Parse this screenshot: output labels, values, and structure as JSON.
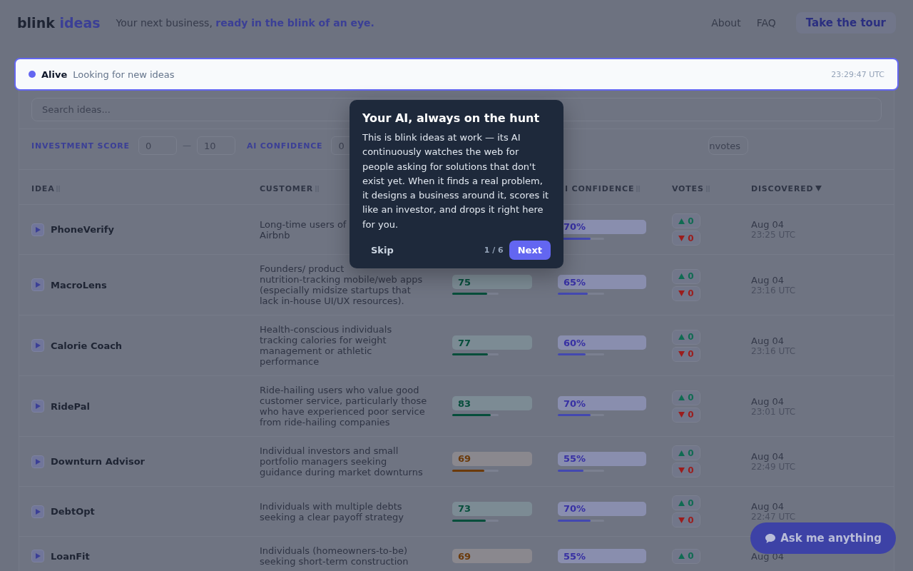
{
  "header": {
    "logo": {
      "first": "blink",
      "second": "ideas"
    },
    "tagline": "Your next business, **ready in the blink of an eye.**",
    "nav": [
      "About",
      "FAQ"
    ],
    "tour_button": "Take the tour"
  },
  "status": {
    "state": "Alive",
    "color": "#6366f1",
    "message": "Looking for new ideas",
    "time": "23:29:47 UTC"
  },
  "search": {
    "placeholder": "Search ideas..."
  },
  "filters": {
    "investment_label": "INVESTMENT SCORE",
    "investment_min": "0",
    "separator": "—",
    "investment_max": "10",
    "confidence_label": "AI CONFIDENCE",
    "confidence_min": "0",
    "downvotes_button": "nvotes"
  },
  "columns": [
    {
      "kind": "idea",
      "label": "IDEA",
      "sorted": false
    },
    {
      "kind": "customer",
      "label": "CUSTOMER",
      "sorted": false
    },
    {
      "kind": "confidence",
      "label": "I CONFIDENCE",
      "sorted": false
    },
    {
      "kind": "votes",
      "label": "VOTES",
      "sorted": false
    },
    {
      "kind": "discovered",
      "label": "DISCOVERED",
      "sorted": true
    }
  ],
  "rows": [
    {
      "name": "PhoneVerify",
      "customer": [
        "Long-time users of",
        "Airbnb"
      ],
      "confidence": {
        "value": "70%",
        "level": 0.7
      },
      "up": "0",
      "down": "0",
      "date": "Aug 04",
      "time": "23:25 UTC"
    },
    {
      "name": "MacroLens",
      "customer": [
        "Founders/ product",
        "nutrition-tracking mobile/web apps",
        "(especially midsize startups that",
        "lack in-house UI/UX resources)."
      ],
      "score": {
        "value": "75",
        "level": 0.75,
        "color": "#064e3b"
      },
      "confidence": {
        "value": "65%",
        "level": 0.65
      },
      "up": "0",
      "down": "0",
      "date": "Aug 04",
      "time": "23:16 UTC"
    },
    {
      "name": "Calorie Coach",
      "customer": [
        "Health-conscious individuals",
        "tracking calories for weight",
        "management or athletic",
        "performance"
      ],
      "score": {
        "value": "77",
        "level": 0.77,
        "color": "#064e3b"
      },
      "confidence": {
        "value": "60%",
        "level": 0.6
      },
      "up": "0",
      "down": "0",
      "date": "Aug 04",
      "time": "23:16 UTC"
    },
    {
      "name": "RidePal",
      "customer": [
        "Ride-hailing users who value good",
        "customer service, particularly those",
        "who have experienced poor service",
        "from ride-hailing companies"
      ],
      "score": {
        "value": "83",
        "level": 0.83,
        "color": "#064e3b"
      },
      "confidence": {
        "value": "70%",
        "level": 0.7
      },
      "up": "0",
      "down": "0",
      "date": "Aug 04",
      "time": "23:01 UTC"
    },
    {
      "name": "Downturn Advisor",
      "customer": [
        "Individual investors and small",
        "portfolio managers seeking",
        "guidance during market downturns"
      ],
      "score": {
        "value": "69",
        "level": 0.69,
        "color": "#6b3a0a"
      },
      "confidence": {
        "value": "55%",
        "level": 0.55
      },
      "up": "0",
      "down": "0",
      "date": "Aug 04",
      "time": "22:49 UTC"
    },
    {
      "name": "DebtOpt",
      "customer": [
        "Individuals with multiple debts",
        "seeking a clear payoff strategy"
      ],
      "score": {
        "value": "73",
        "level": 0.73,
        "color": "#064e3b"
      },
      "confidence": {
        "value": "70%",
        "level": 0.7
      },
      "up": "0",
      "down": "0",
      "date": "Aug 04",
      "time": "22:47 UTC"
    },
    {
      "name": "LoanFit",
      "customer": [
        "Individuals (homeowners-to-be)",
        "seeking short-term construction"
      ],
      "score": {
        "value": "69",
        "color": "#6b3a0a"
      },
      "confidence": {
        "value": "55%"
      },
      "up": "0",
      "date": "Aug 04"
    }
  ],
  "tour": {
    "title": "Your AI, always on the hunt",
    "body": "This is blink ideas at work — its AI continuously watches the web for people asking for solutions that don't exist yet. When it finds a real problem, it designs a business around it, scores it like an investor, and drops it right here for you.",
    "skip": "Skip",
    "step": "1 / 6",
    "next": "Next"
  },
  "chat_button": "Ask me anything"
}
